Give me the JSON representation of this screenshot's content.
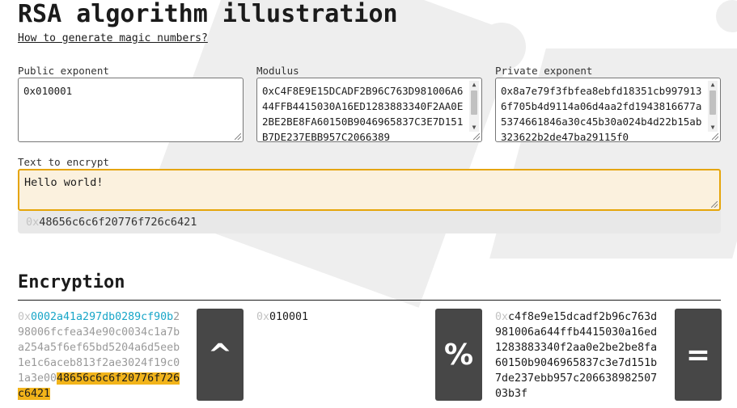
{
  "title": "RSA algorithm illustration",
  "magic_link": "How to generate magic numbers?",
  "fields": {
    "public_exponent": {
      "label": "Public exponent",
      "value": "0x010001"
    },
    "modulus": {
      "label": "Modulus",
      "value": "0xC4F8E9E15DCADF2B96C763D981006A644FFB4415030A16ED1283883340F2AA0E2BE2BE8FA60150B9046965837C3E7D151B7DE237EBB957C2066389"
    },
    "private_exponent": {
      "label": "Private exponent",
      "value": "0x8a7e79f3fbfea8ebfd18351cb9979136f705b4d9114a06d4aa2fd1943816677a5374661846a30c45b30a024b4d22b15ab323622b2de47ba29115f0"
    },
    "text_to_encrypt": {
      "label": "Text to encrypt",
      "value": "Hello world!"
    }
  },
  "text_hex": {
    "prefix": "0x",
    "value": "48656c6c6f20776f726c6421"
  },
  "encryption": {
    "heading": "Encryption",
    "result": {
      "prefix": "0x",
      "cyan": "0002a41a297db0289cf90b",
      "gray": "298006fcfea34e90c0034c1a7ba254a5f6ef65bd5204a6d5eeb1e1c6aceb813f2ae3024f19c01a3e00",
      "highlight": "48656c6c6f20776f726c6421"
    },
    "exponent": {
      "prefix": "0x",
      "value": "010001"
    },
    "modulus": {
      "prefix": "0x",
      "value": "c4f8e9e15dcadf2b96c763d981006a644ffb4415030a16ed1283883340f2aa0e2be2be8fa60150b9046965837c3e7d151b7de237ebb957c20663898250703b3f"
    },
    "operators": {
      "power": "^",
      "mod": "%",
      "equals": "="
    }
  }
}
